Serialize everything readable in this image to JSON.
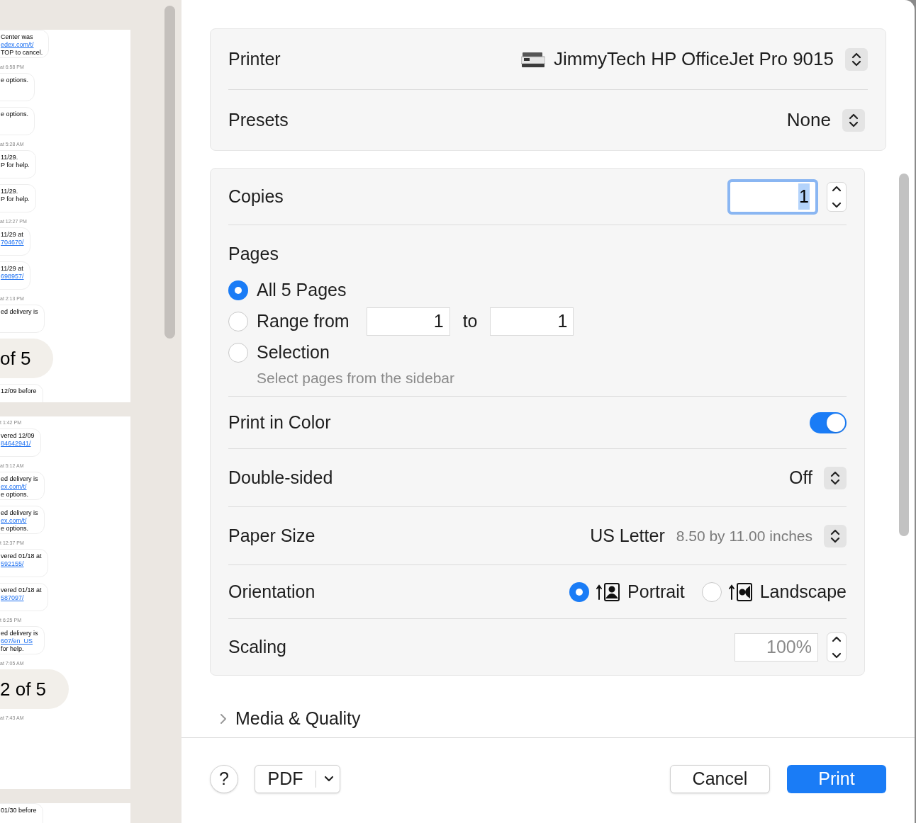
{
  "sidebar": {
    "pages": [
      {
        "items": [
          {
            "kind": "bubble",
            "lines": [
              {
                "text": "Center was",
                "link": false
              },
              {
                "text": "edex.com/t/",
                "link": true
              },
              {
                "text": "TOP to cancel.",
                "link": false
              }
            ]
          },
          {
            "kind": "time",
            "text": "at 6:58 PM"
          },
          {
            "kind": "bubble",
            "lines": [
              {
                "text": "e options.",
                "link": false
              }
            ]
          },
          {
            "kind": "bubble",
            "lines": [
              {
                "text": "e options.",
                "link": false
              }
            ]
          },
          {
            "kind": "time",
            "text": "at 5:28 AM"
          },
          {
            "kind": "bubble",
            "lines": [
              {
                "text": "11/29.",
                "link": false
              },
              {
                "text": "P for help.",
                "link": false
              }
            ]
          },
          {
            "kind": "bubble",
            "lines": [
              {
                "text": "11/29.",
                "link": false
              },
              {
                "text": "P for help.",
                "link": false
              }
            ]
          },
          {
            "kind": "time",
            "text": "at 12:27 PM"
          },
          {
            "kind": "bubble",
            "lines": [
              {
                "text": "11/29 at",
                "link": false
              },
              {
                "text": "704670/",
                "link": true
              }
            ]
          },
          {
            "kind": "bubble",
            "lines": [
              {
                "text": "11/29 at",
                "link": false
              },
              {
                "text": "698957/",
                "link": true
              }
            ]
          },
          {
            "kind": "time",
            "text": "at 2:13 PM"
          },
          {
            "kind": "bubble",
            "lines": [
              {
                "text": "ed delivery is",
                "link": false
              }
            ]
          },
          {
            "kind": "pill",
            "text": "of 5"
          },
          {
            "kind": "bubble",
            "lines": [
              {
                "text": "12/09 before",
                "link": false
              }
            ]
          }
        ]
      },
      {
        "items": [
          {
            "kind": "time",
            "text": "t 1:42 PM"
          },
          {
            "kind": "bubble",
            "lines": [
              {
                "text": "vered 12/09",
                "link": false
              },
              {
                "text": "84642941/",
                "link": true
              }
            ]
          },
          {
            "kind": "time",
            "text": "at 5:12 AM"
          },
          {
            "kind": "bubble",
            "lines": [
              {
                "text": "ed delivery is",
                "link": false
              },
              {
                "text": "ex.com/t/",
                "link": true
              },
              {
                "text": "e options.",
                "link": false
              }
            ]
          },
          {
            "kind": "bubble",
            "lines": [
              {
                "text": "ed delivery is",
                "link": false
              },
              {
                "text": "ex.com/t/",
                "link": true
              },
              {
                "text": "e options.",
                "link": false
              }
            ]
          },
          {
            "kind": "time",
            "text": "t 12:37 PM"
          },
          {
            "kind": "bubble",
            "lines": [
              {
                "text": "vered 01/18 at",
                "link": false
              },
              {
                "text": "592155/",
                "link": true
              }
            ]
          },
          {
            "kind": "bubble",
            "lines": [
              {
                "text": "vered 01/18 at",
                "link": false
              },
              {
                "text": "587097/",
                "link": true
              }
            ]
          },
          {
            "kind": "time",
            "text": "t 6:25 PM"
          },
          {
            "kind": "bubble",
            "lines": [
              {
                "text": "ed delivery is",
                "link": false
              },
              {
                "text": "607/en_US",
                "link": true
              },
              {
                "text": "for help.",
                "link": false
              }
            ]
          },
          {
            "kind": "time",
            "text": "at 7:05 AM"
          },
          {
            "kind": "pill",
            "text": "2 of 5"
          },
          {
            "kind": "time",
            "text": "at 7:43 AM"
          }
        ]
      },
      {
        "items": [
          {
            "kind": "bubble",
            "lines": [
              {
                "text": "01/30 before",
                "link": false
              }
            ]
          }
        ]
      }
    ]
  },
  "printer": {
    "label": "Printer",
    "value": "JimmyTech HP OfficeJet Pro 9015"
  },
  "presets": {
    "label": "Presets",
    "value": "None"
  },
  "copies": {
    "label": "Copies",
    "value": "1"
  },
  "pages": {
    "label": "Pages",
    "options": [
      {
        "kind": "all",
        "label": "All 5 Pages",
        "selected": true
      },
      {
        "kind": "range",
        "label": "Range from",
        "from": "1",
        "to_label": "to",
        "to": "1",
        "selected": false
      },
      {
        "kind": "selection",
        "label": "Selection",
        "hint": "Select pages from the sidebar",
        "selected": false
      }
    ]
  },
  "print_in_color": {
    "label": "Print in Color",
    "on": true
  },
  "double_sided": {
    "label": "Double-sided",
    "value": "Off"
  },
  "paper_size": {
    "label": "Paper Size",
    "value": "US Letter",
    "detail": "8.50 by 11.00 inches"
  },
  "orientation": {
    "label": "Orientation",
    "options": [
      {
        "kind": "portrait",
        "label": "Portrait",
        "selected": true
      },
      {
        "kind": "landscape",
        "label": "Landscape",
        "selected": false
      }
    ]
  },
  "scaling": {
    "label": "Scaling",
    "placeholder": "100%"
  },
  "media_quality": {
    "label": "Media & Quality",
    "expanded": false
  },
  "buttons": {
    "help": "?",
    "pdf": "PDF",
    "cancel": "Cancel",
    "print": "Print"
  }
}
